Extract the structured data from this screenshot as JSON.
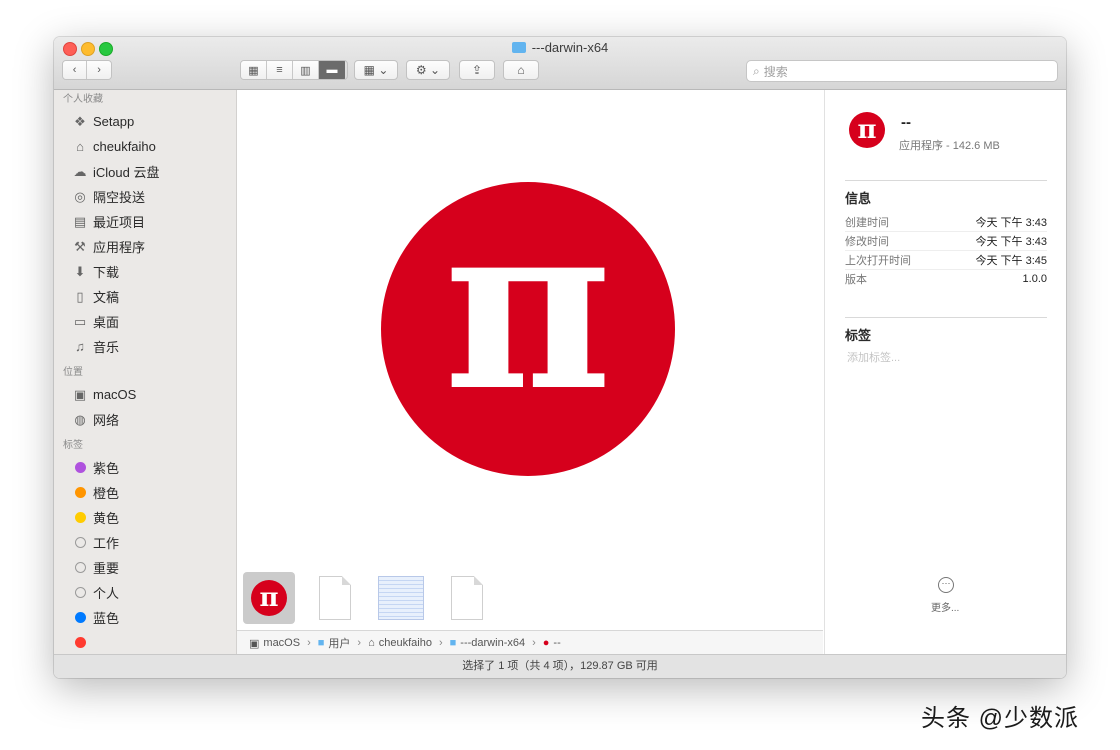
{
  "window": {
    "title": "---darwin-x64"
  },
  "toolbar": {
    "back_icon": "chevron-left-icon",
    "forward_icon": "chevron-right-icon",
    "search_placeholder": "搜索"
  },
  "sidebar": {
    "favorites_header": "个人收藏",
    "favorites": [
      {
        "label": "Setapp",
        "icon": "setapp-icon"
      },
      {
        "label": "cheukfaiho",
        "icon": "home-icon"
      },
      {
        "label": "iCloud 云盘",
        "icon": "cloud-icon"
      },
      {
        "label": "隔空投送",
        "icon": "airdrop-icon"
      },
      {
        "label": "最近项目",
        "icon": "recents-icon"
      },
      {
        "label": "应用程序",
        "icon": "applications-icon"
      },
      {
        "label": "下载",
        "icon": "download-icon"
      },
      {
        "label": "文稿",
        "icon": "documents-icon"
      },
      {
        "label": "桌面",
        "icon": "desktop-icon"
      },
      {
        "label": "音乐",
        "icon": "music-icon"
      }
    ],
    "locations_header": "位置",
    "locations": [
      {
        "label": "macOS",
        "icon": "disk-icon"
      },
      {
        "label": "网络",
        "icon": "network-icon"
      }
    ],
    "tags_header": "标签",
    "tags": [
      {
        "label": "紫色",
        "color": "#af52de"
      },
      {
        "label": "橙色",
        "color": "#ff9500"
      },
      {
        "label": "黄色",
        "color": "#ffcc00"
      },
      {
        "label": "工作",
        "color": ""
      },
      {
        "label": "重要",
        "color": ""
      },
      {
        "label": "个人",
        "color": ""
      },
      {
        "label": "蓝色",
        "color": "#007aff"
      }
    ]
  },
  "preview": {
    "glyph": "π",
    "accent_color": "#d6001c"
  },
  "pathbar": {
    "items": [
      {
        "label": "macOS",
        "icon": "disk-icon"
      },
      {
        "label": "用户",
        "icon": "folder-icon"
      },
      {
        "label": "cheukfaiho",
        "icon": "home-icon"
      },
      {
        "label": "---darwin-x64",
        "icon": "folder-icon"
      },
      {
        "label": "--",
        "icon": "app-icon"
      }
    ]
  },
  "info": {
    "app_name": "--",
    "app_kind": "应用程序 - 142.6 MB",
    "info_header": "信息",
    "rows": [
      {
        "key": "创建时间",
        "value": "今天 下午 3:43"
      },
      {
        "key": "修改时间",
        "value": "今天 下午 3:43"
      },
      {
        "key": "上次打开时间",
        "value": "今天 下午 3:45"
      },
      {
        "key": "版本",
        "value": "1.0.0"
      }
    ],
    "tags_header": "标签",
    "tags_placeholder": "添加标签...",
    "more_label": "更多..."
  },
  "status": {
    "text": "选择了 1 项（共 4 项），129.87 GB 可用"
  },
  "watermark": "头条 @少数派"
}
